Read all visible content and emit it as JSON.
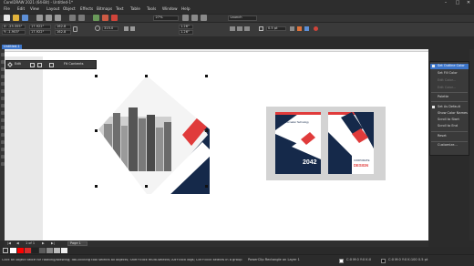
{
  "app": {
    "title": "CorelDRAW 2021 (64-Bit) - Untitled-1*",
    "window_controls": [
      "–",
      "□",
      "✕"
    ]
  },
  "menus": [
    "File",
    "Edit",
    "View",
    "Layout",
    "Object",
    "Effects",
    "Bitmaps",
    "Text",
    "Table",
    "Tools",
    "Window",
    "Help"
  ],
  "toolbar": {
    "zoom": "27%",
    "launch_label": "Launch"
  },
  "property_bar": {
    "x": "X: -23.355\"",
    "y": "Y: -1.903\"",
    "w": "17.922\"",
    "h": "17.922\"",
    "scale_w": "162.8",
    "scale_h": "162.8",
    "rotation": "315.0",
    "nudge1": "1.26\"",
    "nudge2": "1.26\"",
    "outline": "0.5 pt"
  },
  "document": {
    "tab": "Untitled-1"
  },
  "powerclip_toolbar": {
    "edit": "Edit",
    "fit": "Fit Contents"
  },
  "mockup": {
    "cover_number": "2042",
    "cover_left_heading": "Information Technology",
    "cover_right_brand": "CORPORATE",
    "cover_right_title": "DESIGN"
  },
  "context_menu": [
    {
      "label": "Set Outline Color",
      "disabled": false,
      "highlight": true
    },
    {
      "label": "Set Fill Color",
      "disabled": false
    },
    {
      "label": "Edit Color...",
      "disabled": true
    },
    {
      "label": "Edit Color...",
      "disabled": true
    },
    {
      "sep": true
    },
    {
      "label": "Palette",
      "disabled": false
    },
    {
      "sep": true
    },
    {
      "label": "Set As Default",
      "disabled": false
    },
    {
      "label": "Show Color Names",
      "disabled": false
    },
    {
      "label": "Scroll to Start",
      "disabled": false
    },
    {
      "label": "Scroll to End",
      "disabled": false
    },
    {
      "sep": true
    },
    {
      "label": "Reset",
      "disabled": false
    },
    {
      "sep": true
    },
    {
      "label": "Customize...",
      "disabled": false
    }
  ],
  "page_nav": {
    "counter": "1 of 1",
    "page_tab": "Page 1"
  },
  "status": {
    "hint": "Click an object twice for rotating/skewing; dbl-clicking tool selects all objects; Shift+click multi-selects; Alt+click digs; Ctrl+click selects in a group",
    "object": "PowerClip Rectangle on Layer 1",
    "fill": "C:0 M:0 Y:0 K:0",
    "outline": "C:0 M:0 Y:0 K:100  0.5 pt"
  },
  "colors": {
    "accent": "#3d75c9",
    "navy": "#15294a",
    "red": "#e03b3b",
    "palette": [
      "#ffffff",
      "#ff0000",
      "#d62b2b",
      "#222222",
      "#5b5b5b",
      "#8a8a8a",
      "#bdbdbd",
      "#eeeeee"
    ]
  }
}
